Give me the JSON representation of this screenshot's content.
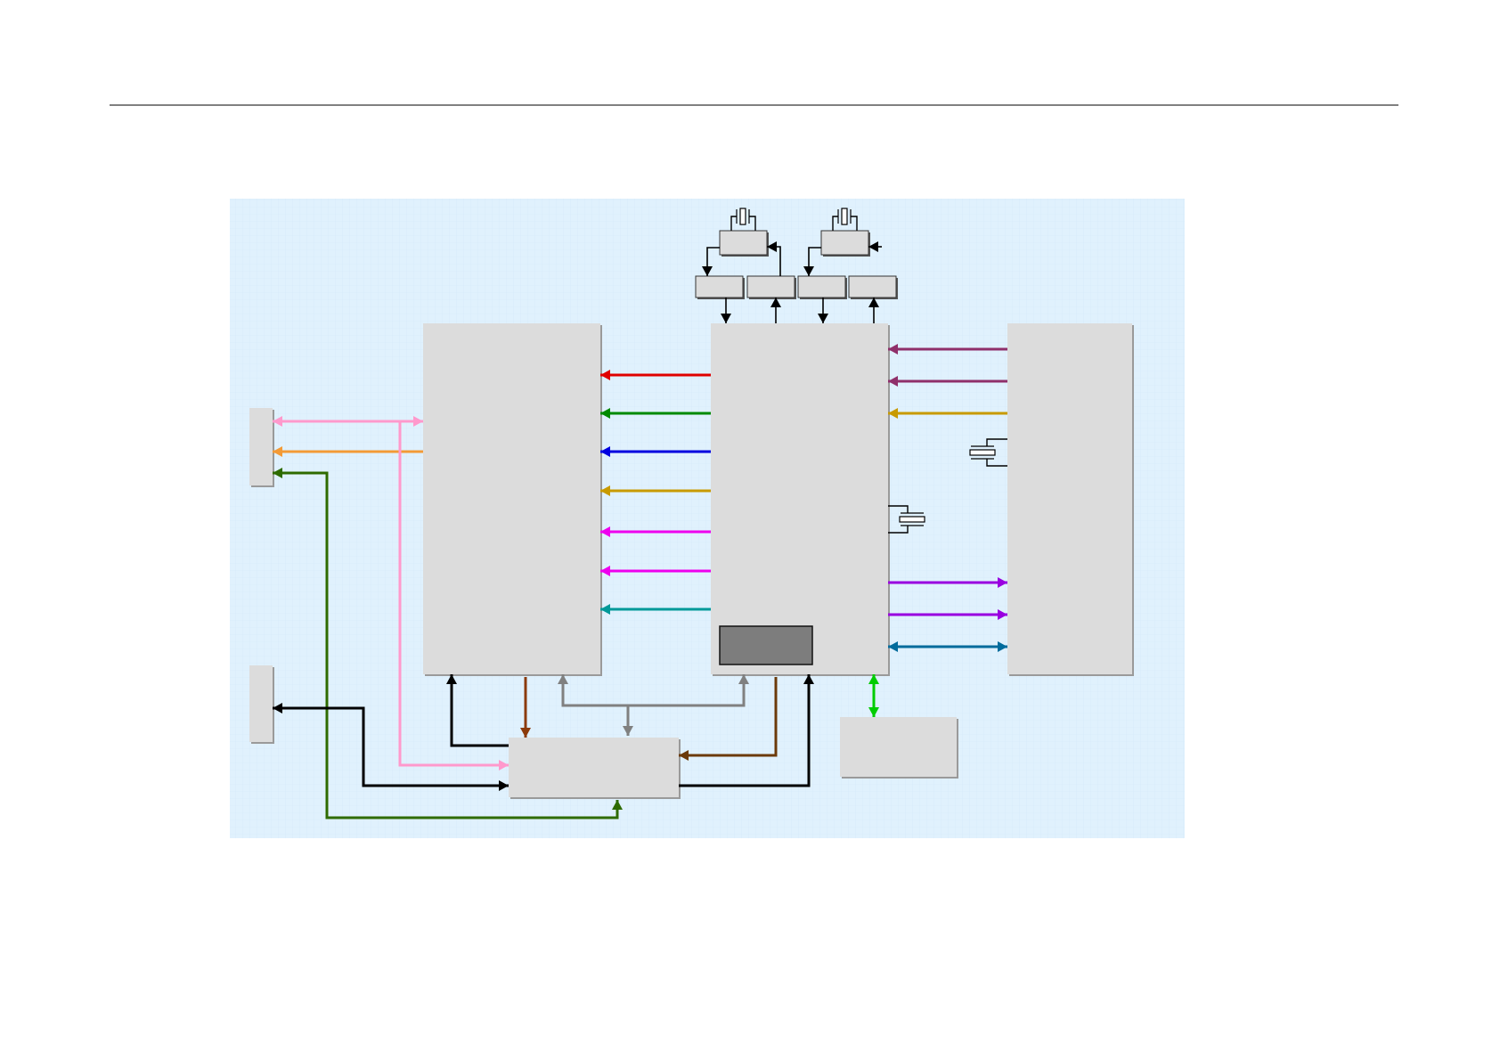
{
  "diagram": {
    "background": "#e0f1fd",
    "block_fill": "#dcdcdc",
    "block_shadow": "#9a9a9a",
    "dark_block_fill": "#7d7d7d",
    "grid_color": "#cfe6f7",
    "rule_color": "#000000",
    "arrow_colors": {
      "red": "#e00000",
      "green": "#008a00",
      "blue": "#0000e0",
      "gold": "#c89a00",
      "magenta": "#ee00ee",
      "teal": "#009999",
      "plum": "#8f2f6a",
      "purple": "#9900e0",
      "steel_blue": "#006b9c",
      "pink": "#ff99cc",
      "orange": "#f39a36",
      "dark_green": "#2e6b00",
      "brown": "#8b3a0a",
      "dark_brown": "#6b3a0a",
      "gray": "#808080",
      "black": "#000000",
      "bright_green": "#00cc00"
    }
  }
}
